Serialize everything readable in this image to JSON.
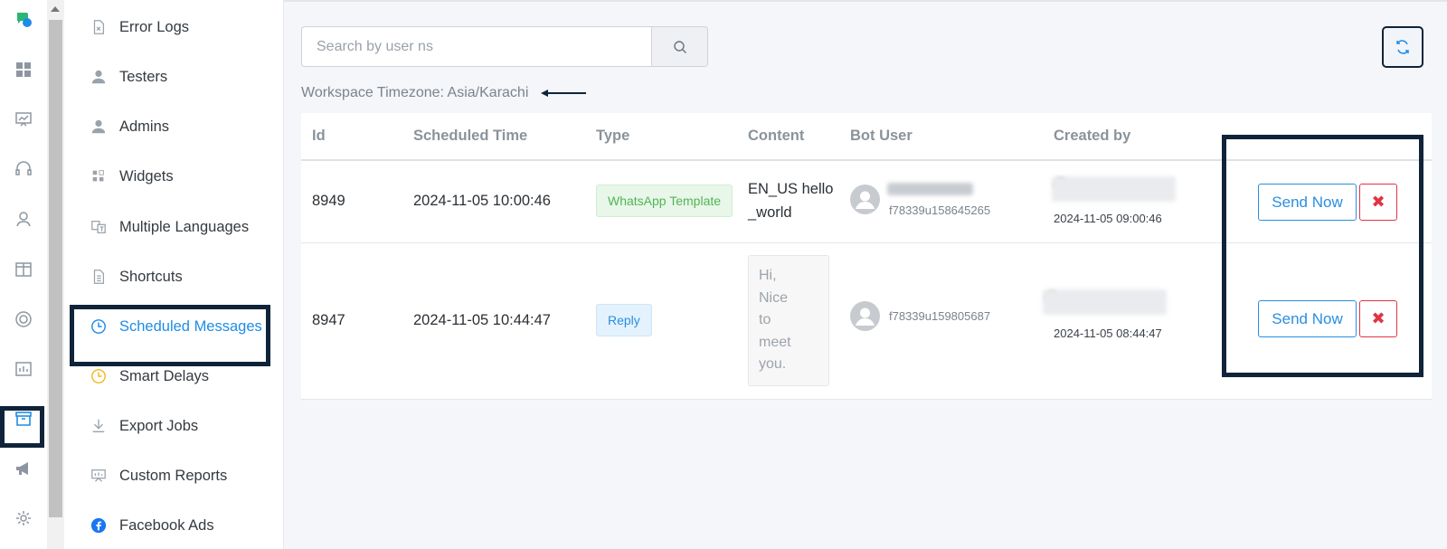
{
  "rail": {
    "icons": [
      "chat-logo-icon",
      "dashboard-grid-icon",
      "presentation-chart-icon",
      "headset-icon",
      "user-icon",
      "columns-icon",
      "support-ring-icon",
      "report-icon",
      "archive-box-icon",
      "megaphone-icon",
      "gear-icon"
    ],
    "active": "archive-box-icon"
  },
  "submenu": {
    "items": [
      {
        "label": "Error Logs",
        "icon": "error-log-icon"
      },
      {
        "label": "Testers",
        "icon": "person-icon"
      },
      {
        "label": "Admins",
        "icon": "person-icon"
      },
      {
        "label": "Widgets",
        "icon": "widget-grid-icon"
      },
      {
        "label": "Multiple Languages",
        "icon": "translate-icon"
      },
      {
        "label": "Shortcuts",
        "icon": "document-icon"
      },
      {
        "label": "Scheduled Messages",
        "icon": "clock-icon",
        "active": true
      },
      {
        "label": "Smart Delays",
        "icon": "clock-icon"
      },
      {
        "label": "Export Jobs",
        "icon": "download-icon"
      },
      {
        "label": "Custom Reports",
        "icon": "presentation-icon"
      },
      {
        "label": "Facebook Ads",
        "icon": "facebook-icon"
      }
    ]
  },
  "search": {
    "placeholder": "Search by user ns"
  },
  "timezone": "Workspace Timezone: Asia/Karachi",
  "table": {
    "headers": [
      "Id",
      "Scheduled Time",
      "Type",
      "Content",
      "Bot User",
      "Created by"
    ],
    "rows": [
      {
        "id": "8949",
        "scheduled_time": "2024-11-05 10:00:46",
        "type": "WhatsApp Template",
        "content_line1": "EN_US hello",
        "content_line2": "_world",
        "bot_user_id": "f78339u158645265",
        "created_at": "2024-11-05 09:00:46",
        "send_label": "Send Now",
        "delete_label": "✖"
      },
      {
        "id": "8947",
        "scheduled_time": "2024-11-05 10:44:47",
        "type": "Reply",
        "content_lines": [
          "Hi,",
          "Nice",
          "to",
          "meet",
          "you."
        ],
        "bot_user_id": "f78339u159805687",
        "created_at": "2024-11-05 08:44:47",
        "send_label": "Send Now",
        "delete_label": "✖"
      }
    ]
  },
  "colors": {
    "accent": "#1f8ce6",
    "annotation": "#0f2439",
    "danger": "#e03444",
    "success": "#52b455"
  }
}
